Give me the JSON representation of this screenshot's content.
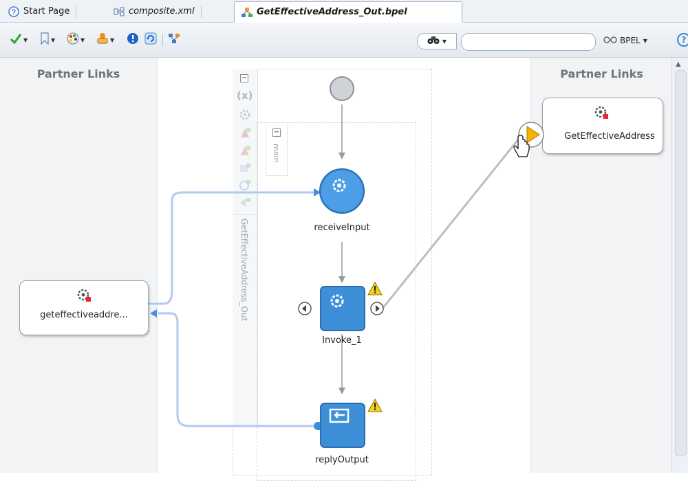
{
  "tabs": [
    {
      "label": "Start Page",
      "icon": "help-circle-icon",
      "active": false
    },
    {
      "label": "composite.xml",
      "icon": "composite-icon",
      "active": false
    },
    {
      "label": "GetEffectiveAddress_Out.bpel",
      "icon": "bpel-process-icon",
      "active": true
    }
  ],
  "toolbar": {
    "search_placeholder": "",
    "bpel_label": "BPEL",
    "buttons": [
      "validate-check-icon",
      "bookmark-icon",
      "palette-icon",
      "deploy-icon",
      "info-icon",
      "refresh-icon",
      "layout-icon"
    ]
  },
  "canvas": {
    "left_lane_title": "Partner Links",
    "right_lane_title": "Partner Links",
    "scope_label": "GetEffectiveAddress_Out",
    "sequence_label": "main",
    "left_partner_link": "geteffectiveaddre...",
    "right_partner_link": "GetEffectiveAddress",
    "activities": [
      {
        "name": "receiveInput",
        "type": "receive"
      },
      {
        "name": "Invoke_1",
        "type": "invoke",
        "warning": true
      },
      {
        "name": "replyOutput",
        "type": "reply",
        "warning": true
      }
    ]
  },
  "colors": {
    "activity_blue": "#3d8fd8",
    "wire_blue": "#aac6f2",
    "warning_yellow": "#f5d417",
    "partner_arrow_orange": "#f4b400"
  }
}
